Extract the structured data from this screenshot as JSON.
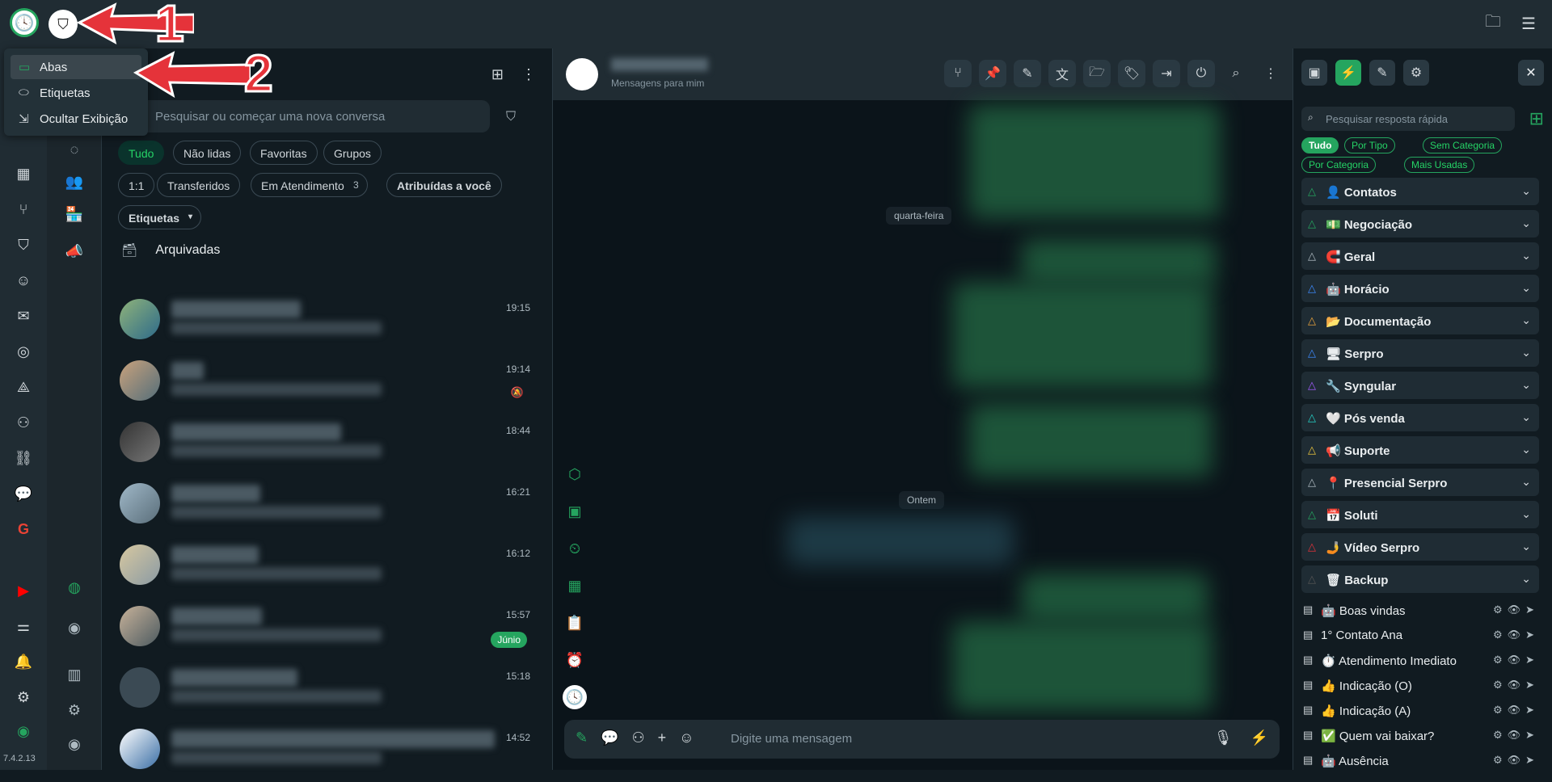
{
  "version": "7.4.2.13",
  "dropdown": {
    "items": [
      {
        "label": "Abas",
        "icon": "tab-icon"
      },
      {
        "label": "Etiquetas",
        "icon": "label-icon"
      },
      {
        "label": "Ocultar Exibição",
        "icon": "hide-view-icon"
      }
    ]
  },
  "annotations": {
    "num1": "1",
    "num2": "2"
  },
  "chatlist": {
    "search_placeholder": "Pesquisar ou começar uma nova conversa",
    "filters_row1": [
      "Tudo",
      "Não lidas",
      "Favoritas",
      "Grupos"
    ],
    "filters_row2": [
      "1:1",
      "Transferidos",
      "Em Atendimento",
      "Atribuídas a você"
    ],
    "em_atendimento_count": "3",
    "etiquetas_label": "Etiquetas",
    "archived_label": "Arquivadas",
    "chats": [
      {
        "time": "19:15",
        "badge": ""
      },
      {
        "time": "19:14",
        "badge": ""
      },
      {
        "time": "18:44",
        "badge": ""
      },
      {
        "time": "16:21",
        "badge": ""
      },
      {
        "time": "16:12",
        "badge": ""
      },
      {
        "time": "15:57",
        "badge": "Júnio"
      },
      {
        "time": "15:18",
        "badge": ""
      },
      {
        "time": "14:52",
        "badge": ""
      }
    ]
  },
  "chat": {
    "subtitle": "Mensagens para mim",
    "day1": "quarta-feira",
    "day2": "Ontem",
    "composer_placeholder": "Digite uma mensagem"
  },
  "quick": {
    "search_placeholder": "Pesquisar resposta rápida",
    "pills": [
      "Tudo",
      "Por Tipo",
      "Sem Categoria",
      "Por Categoria",
      "Mais Usadas"
    ],
    "categories": [
      {
        "label": "Contatos",
        "emoji": "👤"
      },
      {
        "label": "Negociação",
        "emoji": "💵"
      },
      {
        "label": "Geral",
        "emoji": "🧲"
      },
      {
        "label": "Horácio",
        "emoji": "🤖"
      },
      {
        "label": "Documentação",
        "emoji": "📂"
      },
      {
        "label": "Serpro",
        "emoji": "🖥"
      },
      {
        "label": "Syngular",
        "emoji": "🔧"
      },
      {
        "label": "Pós venda",
        "emoji": "🤍"
      },
      {
        "label": "Suporte",
        "emoji": "📢"
      },
      {
        "label": "Presencial Serpro",
        "emoji": "📍"
      },
      {
        "label": "Soluti",
        "emoji": "📅"
      },
      {
        "label": "Vídeo Serpro",
        "emoji": "🤳"
      },
      {
        "label": "Backup",
        "emoji": "🗑"
      }
    ],
    "responses": [
      {
        "label": "🤖 Boas vindas"
      },
      {
        "label": "1° Contato Ana"
      },
      {
        "label": "⏱️ Atendimento Imediato"
      },
      {
        "label": "👍 Indicação (O)"
      },
      {
        "label": "👍 Indicação (A)"
      },
      {
        "label": "✅ Quem vai baixar?"
      },
      {
        "label": "🤖 Ausência"
      }
    ]
  }
}
